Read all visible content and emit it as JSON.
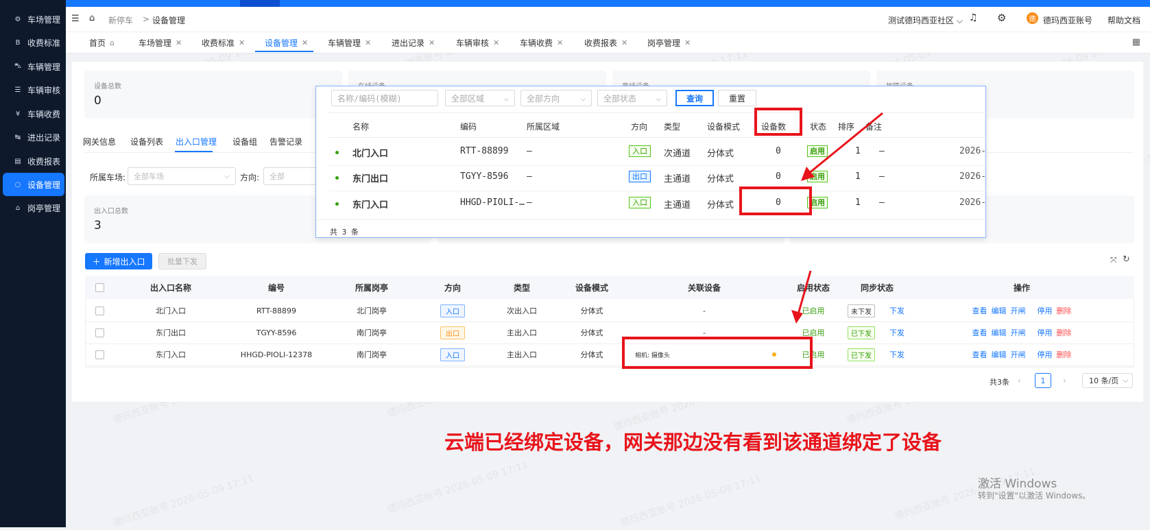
{
  "sidebar": {
    "items": [
      {
        "label": "车场管理",
        "icon": "settings-icon",
        "glyph": "⚙"
      },
      {
        "label": "收费标准",
        "icon": "billing-standard-icon",
        "glyph": "B"
      },
      {
        "label": "车辆管理",
        "icon": "car-icon",
        "glyph": "⛍"
      },
      {
        "label": "车辆审核",
        "icon": "audit-icon",
        "glyph": "☰"
      },
      {
        "label": "车辆收费",
        "icon": "money-icon",
        "glyph": "¥"
      },
      {
        "label": "进出记录",
        "icon": "record-icon",
        "glyph": "↹"
      },
      {
        "label": "收费报表",
        "icon": "report-icon",
        "glyph": "▤"
      },
      {
        "label": "设备管理",
        "icon": "device-icon",
        "glyph": "○"
      },
      {
        "label": "岗亭管理",
        "icon": "booth-icon",
        "glyph": "⌂"
      }
    ]
  },
  "header": {
    "breadcrumb": [
      "新停车",
      "设备管理"
    ],
    "breadcrumb_sep": ">",
    "community": "测试德玛西亚社区",
    "account": "德玛西亚账号",
    "avatar_char": "德",
    "help": "帮助文档"
  },
  "tabs": [
    {
      "label": "首页"
    },
    {
      "label": "车场管理"
    },
    {
      "label": "收费标准"
    },
    {
      "label": "设备管理",
      "active": true
    },
    {
      "label": "车辆管理"
    },
    {
      "label": "进出记录"
    },
    {
      "label": "车辆审核"
    },
    {
      "label": "车辆收费"
    },
    {
      "label": "收费报表"
    },
    {
      "label": "岗亭管理"
    }
  ],
  "stats": {
    "device_total_label": "设备总数",
    "device_total": "0",
    "online_label": "在线设备",
    "offline_label": "离线设备",
    "fault_label": "故障设备",
    "entrance_total_label": "出入口总数",
    "entrance_total": "3"
  },
  "subtabs": [
    "网关信息",
    "设备列表",
    "出入口管理",
    "设备组",
    "告警记录"
  ],
  "filters": {
    "lot_label": "所属车场:",
    "lot_placeholder": "全部车场",
    "direction_label": "方向:",
    "direction_placeholder": "全部"
  },
  "actions": {
    "add": "新增出入口",
    "batch": "批量下发"
  },
  "table": {
    "headers": [
      "出入口名称",
      "编号",
      "所属岗亭",
      "方向",
      "类型",
      "设备模式",
      "关联设备",
      "启用状态",
      "同步状态",
      "操作"
    ],
    "rows": [
      {
        "name": "北门入口",
        "code": "RTT-88899",
        "booth": "北门岗亭",
        "dir": "入口",
        "type": "次出入口",
        "mode": "分体式",
        "device": "-",
        "enabled": "已启用",
        "sync": "未下发",
        "push": "下发"
      },
      {
        "name": "东门出口",
        "code": "TGYY-8596",
        "booth": "南门岗亭",
        "dir": "出口",
        "type": "主出入口",
        "mode": "分体式",
        "device": "-",
        "enabled": "已启用",
        "sync": "已下发",
        "push": "下发"
      },
      {
        "name": "东门入口",
        "code": "HHGD-PIOLI-12378",
        "booth": "南门岗亭",
        "dir": "入口",
        "type": "主出入口",
        "mode": "分体式",
        "device": "相机: 摄像头",
        "enabled": "已启用",
        "sync": "已下发",
        "push": "下发"
      }
    ],
    "ops": [
      "查看",
      "编辑",
      "开闸",
      "停用",
      "删除"
    ]
  },
  "pagination": {
    "total": "共3条",
    "page": "1",
    "size": "10 条/页"
  },
  "popup": {
    "search_placeholder": "名称/编码(模糊)",
    "area": "全部区域",
    "direction": "全部方向",
    "status": "全部状态",
    "query": "查询",
    "reset": "重置",
    "headers": [
      "名称",
      "编码",
      "所属区域",
      "方向",
      "类型",
      "设备模式",
      "设备数",
      "状态",
      "排序",
      "备注"
    ],
    "rows": [
      {
        "name": "北门入口",
        "code": "RTT-88899",
        "area": "—",
        "dir": "入口",
        "type": "次通道",
        "mode": "分体式",
        "count": "0",
        "status": "启用",
        "sort": "1",
        "note": "—",
        "date": "2026-"
      },
      {
        "name": "东门出口",
        "code": "TGYY-8596",
        "area": "—",
        "dir": "出口",
        "type": "主通道",
        "mode": "分体式",
        "count": "0",
        "status": "启用",
        "sort": "1",
        "note": "—",
        "date": "2026-"
      },
      {
        "name": "东门入口",
        "code": "HHGD-PIOLI-…",
        "area": "—",
        "dir": "入口",
        "type": "主通道",
        "mode": "分体式",
        "count": "0",
        "status": "启用",
        "sort": "1",
        "note": "—",
        "date": "2026-"
      }
    ],
    "total": "共 3 条"
  },
  "annotation": "云端已经绑定设备，网关那边没有看到该通道绑定了设备",
  "watermark": "德玛西亚账号 2026-05-09 17:11",
  "windows": {
    "line1": "激活 Windows",
    "line2": "转到\"设置\"以激活 Windows。"
  },
  "colors": {
    "primary": "#1677ff",
    "sidebar": "#0e1a2c",
    "annotation_red": "#e8141b"
  }
}
